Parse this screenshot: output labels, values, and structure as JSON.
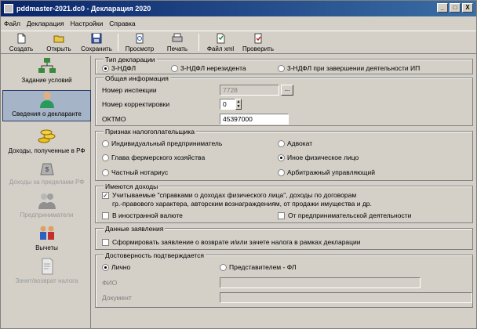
{
  "window": {
    "title": "pddmaster-2021.dc0 - Декларация 2020",
    "btn_min": "_",
    "btn_max": "□",
    "btn_close": "X"
  },
  "menu": [
    "Файл",
    "Декларация",
    "Настройки",
    "Справка"
  ],
  "toolbar": {
    "create": "Создать",
    "open": "Открыть",
    "save": "Сохранить",
    "preview": "Просмотр",
    "print": "Печать",
    "xml": "Файл xml",
    "check": "Проверить"
  },
  "sidebar": [
    {
      "label": "Задание условий",
      "icon": "network-icon",
      "selected": false,
      "disabled": false
    },
    {
      "label": "Сведения о декларанте",
      "icon": "person-icon",
      "selected": true,
      "disabled": false
    },
    {
      "label": "Доходы, полученные в РФ",
      "icon": "coins-icon",
      "selected": false,
      "disabled": false
    },
    {
      "label": "Доходы за пределами РФ",
      "icon": "money-bag-icon",
      "selected": false,
      "disabled": true
    },
    {
      "label": "Предприниматели",
      "icon": "businessmen-icon",
      "selected": false,
      "disabled": true
    },
    {
      "label": "Вычеты",
      "icon": "family-icon",
      "selected": false,
      "disabled": false
    },
    {
      "label": "Зачет/возврат налога",
      "icon": "document-icon",
      "selected": false,
      "disabled": true
    }
  ],
  "declaration_type": {
    "title": "Тип декларации",
    "options": [
      "3-НДФЛ",
      "3-НДФЛ нерезидента",
      "3-НДФЛ при завершении деятельности ИП"
    ],
    "selected": 0
  },
  "general": {
    "title": "Общая информация",
    "inspection_label": "Номер инспекции",
    "inspection_value": "7728",
    "inspection_btn": "...",
    "correction_label": "Номер корректировки",
    "correction_value": "0",
    "oktmo_label": "ОКТМО",
    "oktmo_value": "45397000"
  },
  "taxpayer": {
    "title": "Признак налогоплательщика",
    "options": [
      "Индивидуальный предприниматель",
      "Адвокат",
      "Глава фермерского хозяйства",
      "Иное физическое лицо",
      "Частный нотариус",
      "Арбитражный управляющий"
    ],
    "selected": "Иное физическое лицо"
  },
  "income": {
    "title": "Имеются доходы",
    "cb1_line1": "Учитываемые \"справками о доходах физического лица\", доходы по договорам",
    "cb1_line2": "гр.-правового характера, авторским вознаграждениям, от продажи имущества и др.",
    "cb1_checked": true,
    "cb1_mark": "✓",
    "cb2": "В иностранной валюте",
    "cb3": "От предпринимательской деятельности"
  },
  "statement": {
    "title": "Данные заявления",
    "cb": "Сформировать заявление о  возврате и/или зачете налога в рамках декларации"
  },
  "authenticity": {
    "title": "Достоверность подтверждается",
    "opt1": "Лично",
    "opt2": "Представителем - ФЛ",
    "fio_label": "ФИО",
    "doc_label": "Документ"
  }
}
